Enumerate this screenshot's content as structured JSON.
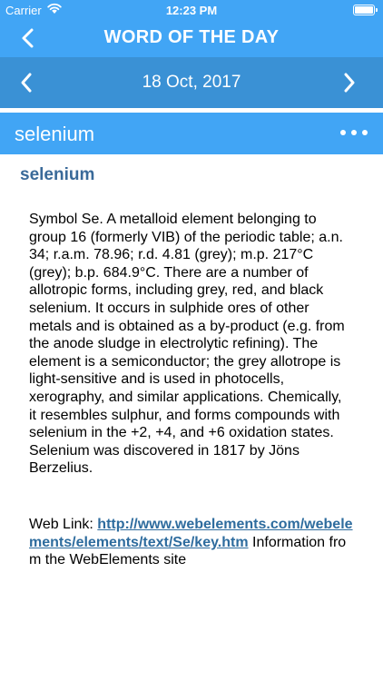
{
  "status": {
    "carrier": "Carrier",
    "time": "12:23 PM"
  },
  "navbar": {
    "title": "WORD OF THE DAY"
  },
  "datebar": {
    "date": "18 Oct, 2017"
  },
  "word": {
    "title": "selenium",
    "heading": "selenium"
  },
  "definition": "Symbol Se. A metalloid element belonging to group 16 (formerly VIB) of the periodic table; a.n. 34; r.a.m. 78.96; r.d. 4.81 (grey); m.p. 217°C (grey); b.p. 684.9°C. There are a number of allotropic forms, including grey, red, and black selenium. It occurs in sulphide ores of other metals and is obtained as a by-product (e.g. from the anode sludge in electrolytic refining). The element is a semiconductor; the grey allotrope is light-sensitive and is used in photocells, xerography, and similar applications. Chemically, it resembles sulphur, and forms compounds with selenium in the +2, +4, and +6 oxidation states. Selenium was discovered in 1817 by Jöns Berzelius.",
  "weblink": {
    "prefix": "Web Link: ",
    "url": "http://www.webelements.com/webelements/elements/text/Se/key.htm",
    "suffix": " Information from the WebElements site"
  },
  "colors": {
    "primary": "#41a5f5",
    "date_bar": "#3a91d5",
    "heading": "#3a6a99",
    "link": "#2e6c9e"
  },
  "icons": {
    "status": [
      "wifi-icon",
      "battery-icon"
    ],
    "navbar": [
      "back-arrow-icon"
    ],
    "datebar": [
      "chevron-left-icon",
      "chevron-right-icon"
    ],
    "wordbar": [
      "more-options-icon"
    ]
  }
}
